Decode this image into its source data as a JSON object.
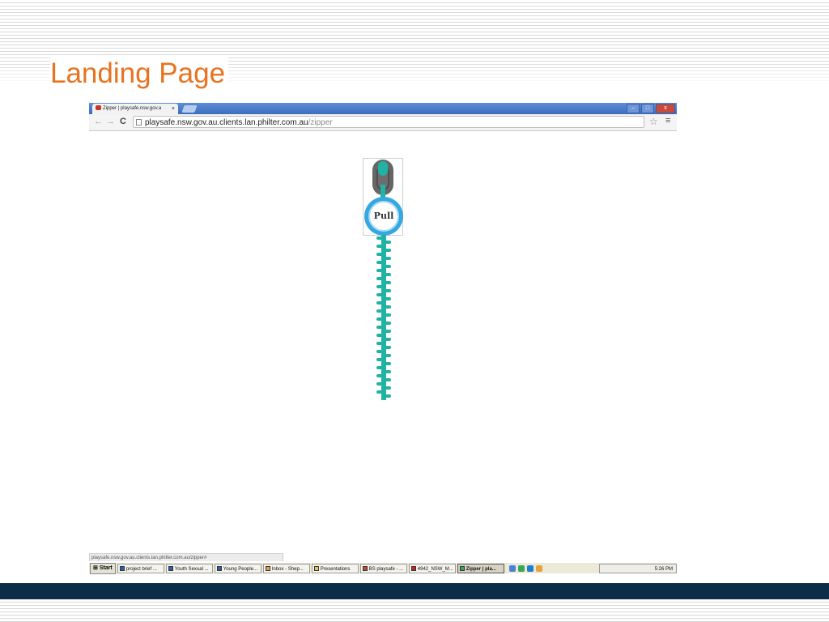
{
  "slide": {
    "title": "Landing Page"
  },
  "browser": {
    "tab_title": "Zipper | playsafe.nsw.gov.a",
    "tab_close": "×",
    "window_buttons": [
      "–",
      "□",
      "x"
    ],
    "url_host": "playsafe.nsw.gov.au.clients.lan.philter.com.au",
    "url_path": "/zipper"
  },
  "zipper": {
    "pull_label": "Pull",
    "teeth_count": 40
  },
  "statusbar": {
    "text": "playsafe.nsw.gov.au.clients.lan.philter.com.au/zipper#"
  },
  "taskbar": {
    "start_label": "Start",
    "items": [
      {
        "label": "project brief ...",
        "icon": "word-icon",
        "color": "#2b5fb3"
      },
      {
        "label": "Youth Sexual ...",
        "icon": "word-icon",
        "color": "#2b5fb3"
      },
      {
        "label": "Young People...",
        "icon": "word-icon",
        "color": "#2b5fb3"
      },
      {
        "label": "Inbox - Shep...",
        "icon": "outlook-icon",
        "color": "#e8a43a"
      },
      {
        "label": "Presentations",
        "icon": "folder-icon",
        "color": "#f0c848"
      },
      {
        "label": "BS playsafe - ...",
        "icon": "powerpoint-icon",
        "color": "#d24726"
      },
      {
        "label": "4942_NSW_M...",
        "icon": "pdf-icon",
        "color": "#cc2222"
      },
      {
        "label": "Zipper | pla...",
        "icon": "chrome-icon",
        "color": "#3aa757",
        "active": true
      }
    ],
    "clock": "5:26 PM"
  },
  "colors": {
    "title": "#e8731f",
    "teeth": "#20b2a4",
    "pull": "#35a8e0",
    "band": "#0d2c48"
  }
}
